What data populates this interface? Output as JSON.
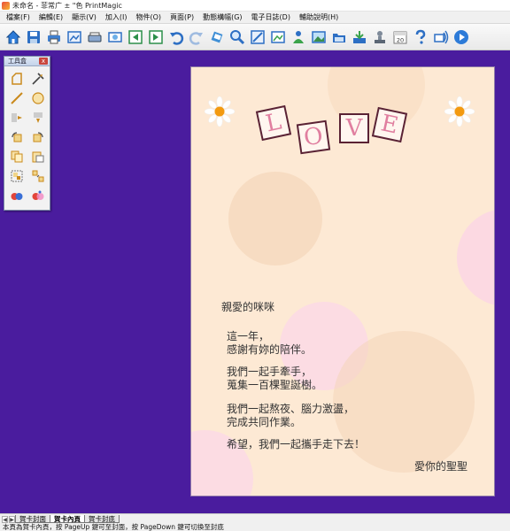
{
  "window": {
    "title": "未命名 - 菲常广 ± \"色 PrintMagic"
  },
  "menu": {
    "items": [
      "檔案(F)",
      "編輯(E)",
      "顯示(V)",
      "加入(I)",
      "物件(O)",
      "頁面(P)",
      "動態構幅(G)",
      "電子日誌(D)",
      "輔助說明(H)"
    ]
  },
  "toolbar": {
    "icons": [
      "home-icon",
      "save-icon",
      "print-icon",
      "print-preview-icon",
      "scan-icon",
      "photo-icon",
      "prev-page-icon",
      "next-page-icon",
      "undo-icon",
      "redo-icon",
      "rotate-icon",
      "zoom-icon",
      "image-edit-icon",
      "image-frame-icon",
      "person-icon",
      "landscape-icon",
      "open-folder-icon",
      "download-icon",
      "stamp-icon",
      "calendar-icon",
      "help-icon",
      "network-icon",
      "play-icon"
    ],
    "calendar_day": "20"
  },
  "toolbox": {
    "title": "工具盒",
    "close": "x"
  },
  "card": {
    "letters": [
      "L",
      "O",
      "V",
      "E"
    ],
    "greeting": "親愛的咪咪",
    "lines": [
      "這一年，",
      "感謝有妳的陪伴。",
      "我們一起手牽手，",
      "蒐集一百棵聖誕樹。",
      "我們一起熬夜、腦力激盪，",
      "完成共同作業。",
      "希望，我們一起攜手走下去！"
    ],
    "signature": "愛你的聖聖",
    "colors": {
      "background": "#fde9d4",
      "letters": "#e07fa0",
      "frame": "#5a2234"
    }
  },
  "tabs": {
    "nav_prev": "◀",
    "nav_next": "▶",
    "items": [
      "賀卡封面",
      "賀卡內頁",
      "賀卡封底"
    ],
    "active_index": 1
  },
  "status": {
    "text": "本頁為賀卡內頁，按 PageUp 鍵可至封面，按 PageDown 鍵可切換至封底"
  },
  "colors": {
    "workspace": "#4a1c9e",
    "accent": "#2d7bd8"
  }
}
